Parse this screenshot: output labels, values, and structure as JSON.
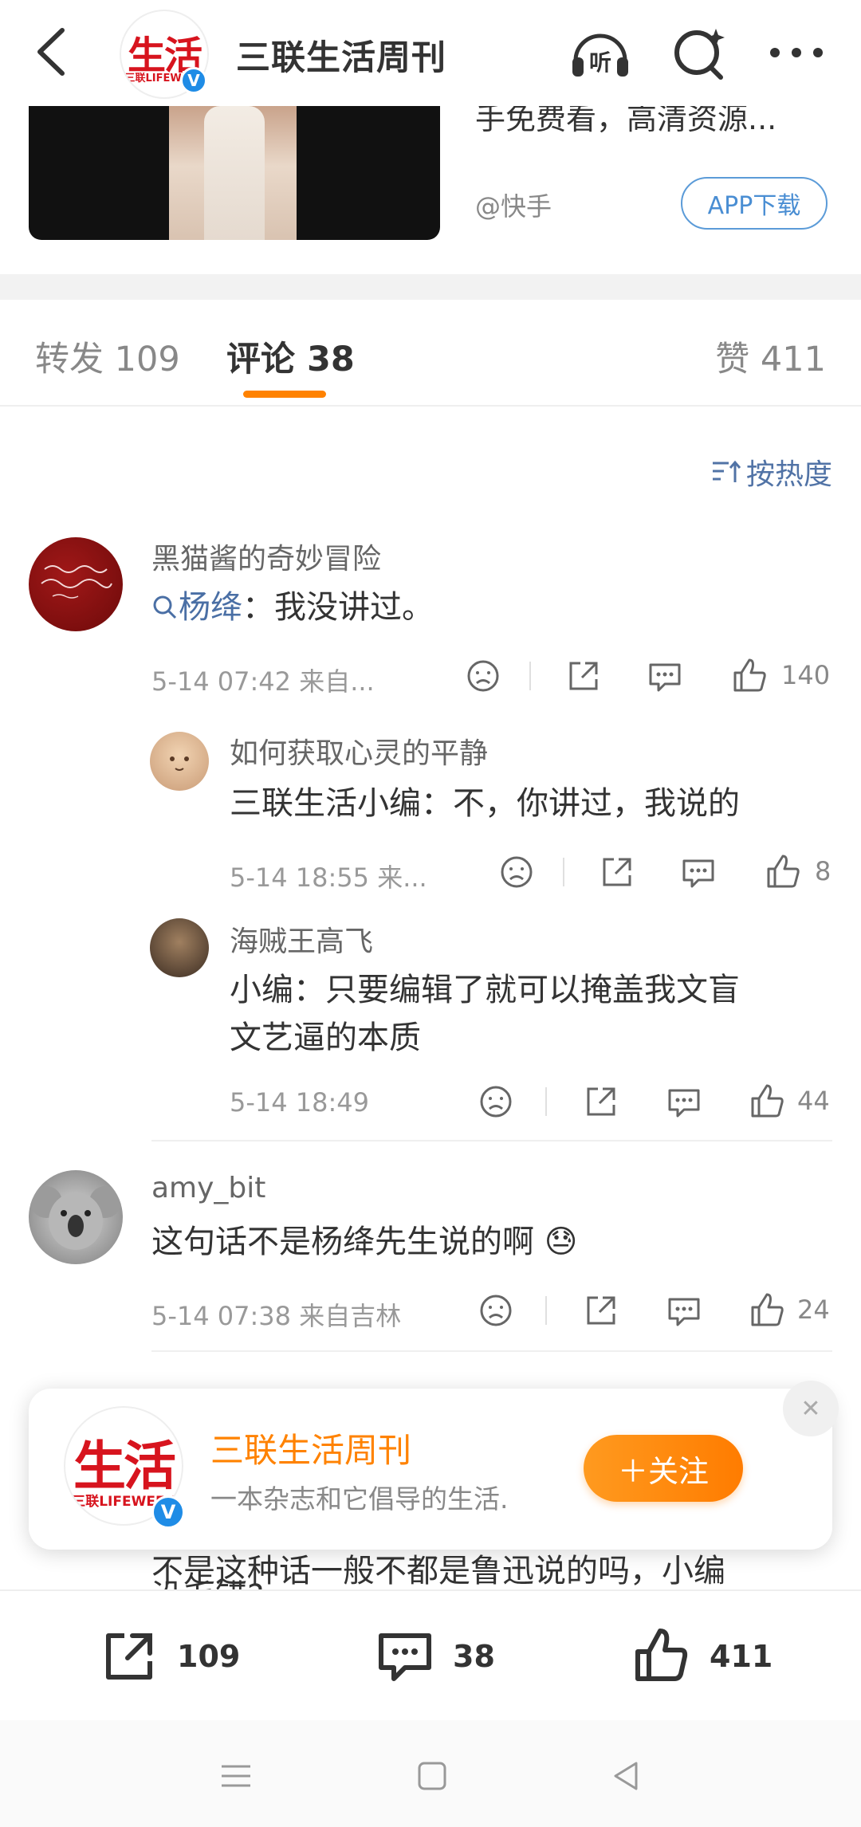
{
  "header": {
    "title": "三联生活周刊",
    "logo_text": "生活",
    "logo_sub": "三联LIFEWEEK",
    "verified_mark": "V",
    "icons": [
      "back-icon",
      "listen-icon",
      "search-icon",
      "more-icon"
    ]
  },
  "card": {
    "text": "手免费看，高清资源...",
    "source": "@快手",
    "app_button": "APP下载"
  },
  "tabs": {
    "repost": "转发 109",
    "comments": "评论 38",
    "likes": "赞 411"
  },
  "sort": {
    "label": "按热度"
  },
  "comments": [
    {
      "user": "黑猫酱的奇妙冒险",
      "mention": "杨绛",
      "text": "：我没讲过。",
      "time": "5-14 07:42  来自...",
      "likes": "140"
    },
    {
      "user": "如何获取心灵的平静",
      "text": "三联生活小编：不，你讲过，我说的",
      "time": "5-14 18:55  来...",
      "likes": "8"
    },
    {
      "user": "海贼王高飞",
      "text_line1": "小编：只要编辑了就可以掩盖我文盲",
      "text_line2": "文艺逼的本质",
      "time": "5-14 18:49",
      "likes": "44"
    },
    {
      "user": "amy_bit",
      "text": "这句话不是杨绛先生说的啊 😓",
      "time": "5-14 07:38  来自吉林",
      "likes": "24"
    }
  ],
  "popup": {
    "title": "三联生活周刊",
    "subtitle": "一本杂志和它倡导的生活.",
    "follow_button": "＋关注",
    "close": "✕"
  },
  "hidden_comment": {
    "line_partial": "不是这种话一般不都是鲁迅说的吗，小编",
    "line_partial2": "没毛错?"
  },
  "bottom_bar": {
    "reposts": "109",
    "comments": "38",
    "likes": "411"
  },
  "colors": {
    "accent_orange": "#ff8200",
    "link_blue": "#4a6fa5",
    "verified_blue": "#1f8ce6",
    "brand_red": "#d7141e"
  }
}
